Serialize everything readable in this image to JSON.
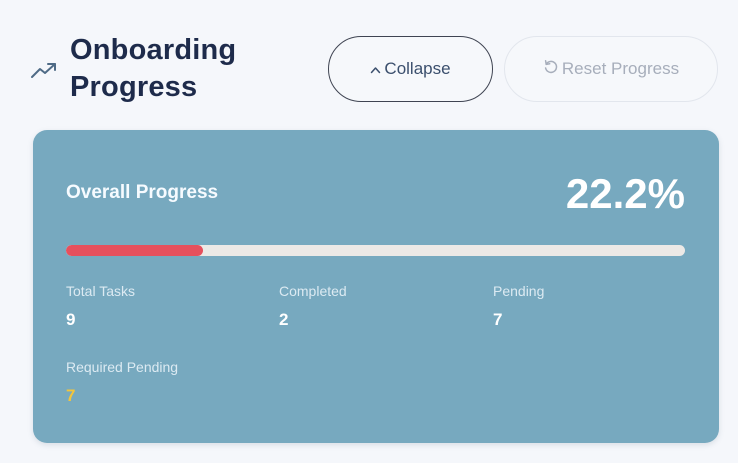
{
  "header": {
    "title_line1": "Onboarding",
    "title_line2": "Progress",
    "icon": "trending-up-icon",
    "collapse_label": "Collapse",
    "collapse_icon": "chevron-up-icon",
    "reset_label": "Reset Progress",
    "reset_icon": "refresh-icon"
  },
  "card": {
    "title": "Overall Progress",
    "percent_text": "22.2%",
    "progress_fraction": 0.222,
    "bar_fill_color": "#e6505d",
    "bar_track_color": "#ece9e6",
    "background_color": "#77a9bf",
    "stats": [
      {
        "label": "Total Tasks",
        "value": "9"
      },
      {
        "label": "Completed",
        "value": "2"
      },
      {
        "label": "Pending",
        "value": "7"
      },
      {
        "label": "Required Pending",
        "value": "7",
        "highlight_color": "#f3c53b"
      }
    ]
  }
}
